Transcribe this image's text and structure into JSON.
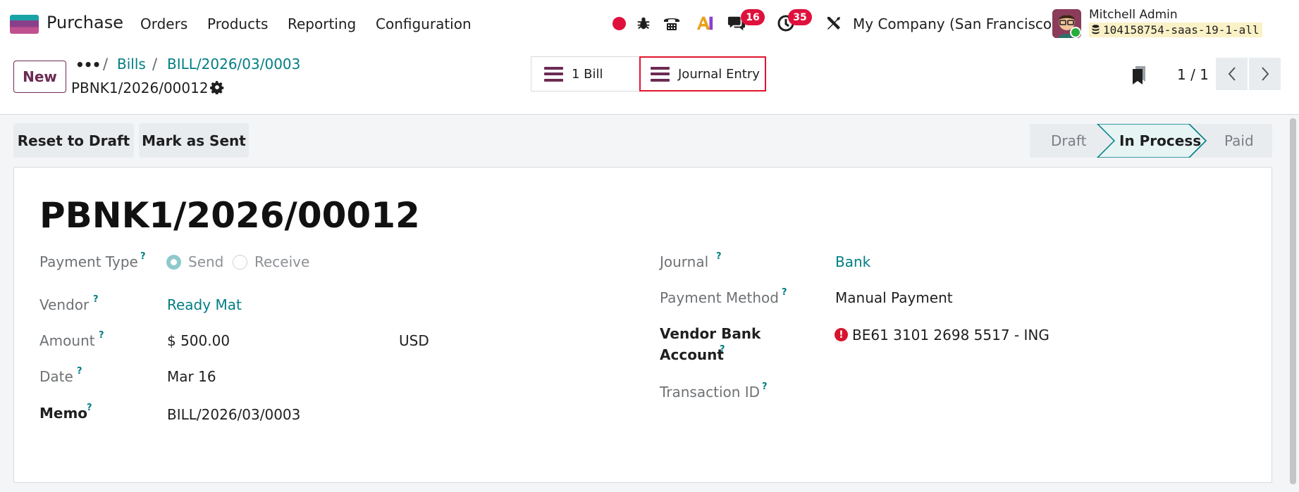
{
  "navbar": {
    "app_name": "Purchase",
    "menu": [
      "Orders",
      "Products",
      "Reporting",
      "Configuration"
    ],
    "chat_badge": "16",
    "activity_badge": "35",
    "company": "My Company (San Francisco)",
    "user_name": "Mitchell Admin",
    "database": "104158754-saas-19-1-all",
    "colors": {
      "recording": "#e0103c",
      "badge": "#e0103c",
      "brand": "#6c2b53"
    }
  },
  "control_panel": {
    "new_label": "New",
    "more_label": "•••",
    "breadcrumb": [
      "Bills",
      "BILL/2026/03/0003"
    ],
    "record_name": "PBNK1/2026/00012",
    "smart_buttons": [
      {
        "label": "1 Bill",
        "icon": "list-icon"
      },
      {
        "label": "Journal Entry",
        "icon": "list-icon"
      }
    ],
    "pager": {
      "value": "1 / 1"
    }
  },
  "actions": {
    "reset_to_draft": "Reset to Draft",
    "mark_as_sent": "Mark as Sent"
  },
  "statusbar": {
    "stages": [
      "Draft",
      "In Process",
      "Paid"
    ],
    "current": "In Process"
  },
  "form": {
    "title": "PBNK1/2026/00012",
    "help_mark": "?",
    "payment_type": {
      "label": "Payment Type",
      "options": [
        "Send",
        "Receive"
      ],
      "selected": "Send"
    },
    "vendor": {
      "label": "Vendor",
      "value": "Ready Mat"
    },
    "amount": {
      "label": "Amount",
      "value": "$ 500.00",
      "currency": "USD"
    },
    "date": {
      "label": "Date",
      "value": "Mar 16"
    },
    "memo": {
      "label": "Memo",
      "value": "BILL/2026/03/0003"
    },
    "journal": {
      "label": "Journal",
      "value": "Bank"
    },
    "payment_method": {
      "label": "Payment Method",
      "value": "Manual Payment"
    },
    "vendor_bank_account": {
      "label_line1": "Vendor Bank",
      "label_line2": "Account",
      "value": "BE61 3101 2698 5517 - ING",
      "warning": "!"
    },
    "transaction_id": {
      "label": "Transaction ID",
      "value": ""
    }
  }
}
